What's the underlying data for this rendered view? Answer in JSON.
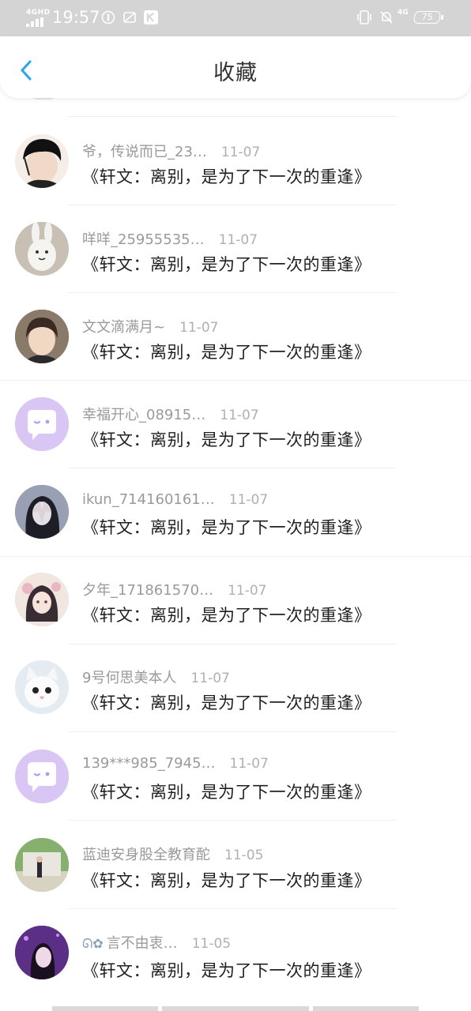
{
  "status_bar": {
    "network": "4GHD",
    "time": "19:57",
    "battery": "75",
    "right_signal": "4G"
  },
  "header": {
    "title": "收藏",
    "back_icon": "chevron-left-icon"
  },
  "colors": {
    "accent": "#2aa3f0",
    "status_bar_bg": "#d4d4d4",
    "name_gray": "#9a9a9a",
    "default_avatar_bg": "#d9c6f5"
  },
  "items": [
    {
      "name": "爷，传说而已_23…",
      "date": "11-07",
      "title": "《轩文：离别，是为了下一次的重逢》",
      "avatar": "boy-with-earphones-avatar"
    },
    {
      "name": "咩咩_25955535…",
      "date": "11-07",
      "title": "《轩文：离别，是为了下一次的重逢》",
      "avatar": "white-plush-toy-avatar"
    },
    {
      "name": "文文滴满月~",
      "date": "11-07",
      "title": "《轩文：离别，是为了下一次的重逢》",
      "avatar": "boy-portrait-avatar"
    },
    {
      "name": "幸福开心_08915…",
      "date": "11-07",
      "title": "《轩文：离别，是为了下一次的重逢》",
      "avatar": "default-chat-avatar"
    },
    {
      "name": "ikun_714160161…",
      "date": "11-07",
      "title": "《轩文：离别，是为了下一次的重逢》",
      "avatar": "girl-covering-face-avatar"
    },
    {
      "name": "夕年_171861570…",
      "date": "11-07",
      "title": "《轩文：离别，是为了下一次的重逢》",
      "avatar": "anime-girl-avatar"
    },
    {
      "name": "9号何思美本人",
      "date": "11-07",
      "title": "《轩文：离别，是为了下一次的重逢》",
      "avatar": "white-kitten-avatar"
    },
    {
      "name": "139***985_7945…",
      "date": "11-07",
      "title": "《轩文：离别，是为了下一次的重逢》",
      "avatar": "default-chat-avatar"
    },
    {
      "name": "蓝迪安身股全教育酡",
      "date": "11-05",
      "title": "《轩文：离别，是为了下一次的重逢》",
      "avatar": "outdoor-photo-avatar"
    },
    {
      "name": "言不由衷…",
      "date": "11-05",
      "title": "《轩文：离别，是为了下一次的重逢》",
      "avatar": "girl-purple-light-avatar"
    }
  ]
}
